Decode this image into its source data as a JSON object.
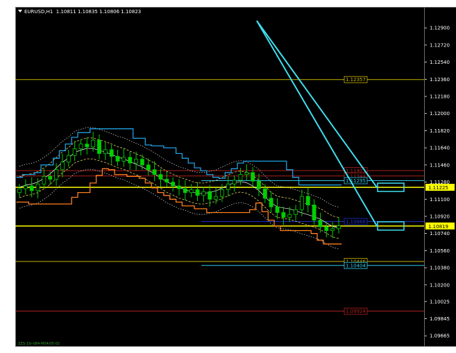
{
  "header": {
    "symbol": "EURUSD,H1",
    "ohlc": "1.10811 1.10835 1.10806 1.10823"
  },
  "footer": {
    "text": "ZZS-15r-084-M04/05-02"
  },
  "colors": {
    "background": "#000000",
    "candle": "#00d000",
    "axis_text": "#ffffff",
    "level_gold": "#c8b400",
    "level_red": "#b02020",
    "level_cyan": "#30c8e8",
    "level_yellow": "#ffff00",
    "level_blue": "#2030d0",
    "arrow": "#40e0f0",
    "step_orange": "#ff8020",
    "step_blue": "#20a0e0"
  },
  "chart_data": {
    "type": "candlestick",
    "symbol": "EURUSD",
    "timeframe": "H1",
    "ylim": [
      1.0955,
      1.1312
    ],
    "y_ticks": [
      "1.12900",
      "1.12720",
      "1.12540",
      "1.12360",
      "1.12180",
      "1.12000",
      "1.11820",
      "1.11640",
      "1.11460",
      "1.11280",
      "1.11100",
      "1.10920",
      "1.10740",
      "1.10560",
      "1.10380",
      "1.10200",
      "1.10025",
      "1.09845",
      "1.09665"
    ],
    "close": [
      1.1121,
      1.1124,
      1.1119,
      1.1126,
      1.1134,
      1.1131,
      1.1141,
      1.1149,
      1.1156,
      1.1163,
      1.1168,
      1.1165,
      1.1172,
      1.1158,
      1.1162,
      1.1155,
      1.115,
      1.1154,
      1.1148,
      1.1152,
      1.1146,
      1.1141,
      1.1136,
      1.1131,
      1.1128,
      1.1124,
      1.1121,
      1.1117,
      1.112,
      1.1114,
      1.1118,
      1.111,
      1.1113,
      1.112,
      1.1126,
      1.113,
      1.1136,
      1.1138,
      1.1129,
      1.1121,
      1.1111,
      1.1102,
      1.1096,
      1.1091,
      1.1094,
      1.1099,
      1.1113,
      1.1104,
      1.1088,
      1.1081,
      1.1077,
      1.1079,
      1.1082
    ],
    "levels": [
      {
        "label": "1.12357",
        "value": 1.12357,
        "color": "#c8b400"
      },
      {
        "label": "1.11401",
        "value": 1.11401,
        "color": "#b02020"
      },
      {
        "label": "1.11344",
        "value": 1.11344,
        "color": "#b02020"
      },
      {
        "label": "1.11295",
        "value": 1.11295,
        "color": "#30c8e8"
      },
      {
        "label": "1.11225",
        "value": 1.11225,
        "color": "#ffff00"
      },
      {
        "label": "1.10866",
        "value": 1.10866,
        "color": "#2030d0"
      },
      {
        "label": "1.10819",
        "value": 1.10819,
        "color": "#ffff00"
      },
      {
        "label": "1.10446",
        "value": 1.10446,
        "color": "#c8b400"
      },
      {
        "label": "1.10404",
        "value": 1.10404,
        "color": "#30c8e8"
      },
      {
        "label": "1.09924",
        "value": 1.09924,
        "color": "#b02020"
      }
    ],
    "price_tags": [
      {
        "label": "1.11225",
        "value": 1.11225,
        "bg": "#ffff00",
        "fg": "#000000"
      },
      {
        "label": "1.10819",
        "value": 1.10819,
        "bg": "#ffff00",
        "fg": "#000000"
      }
    ]
  }
}
